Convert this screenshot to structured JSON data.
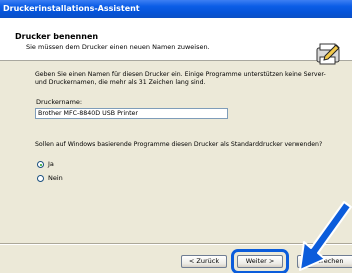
{
  "window": {
    "title": "Druckerinstallations-Assistent"
  },
  "header": {
    "title": "Drucker benennen",
    "subtitle": "Sie müssen dem Drucker einen neuen Namen zuweisen.",
    "icon": "printer-pencil-icon"
  },
  "content": {
    "intro": "Geben Sie einen Namen für diesen Drucker ein. Einige Programme unterstützen keine Server- und Druckernamen, die mehr als 31 Zeichen lang sind.",
    "name_label": "Druckername:",
    "name_value": "Brother MFC-8840D USB Printer",
    "question": "Sollen auf Windows basierende Programme diesen Drucker als Standarddrucker verwenden?",
    "options": [
      {
        "label": "Ja",
        "selected": true
      },
      {
        "label": "Nein",
        "selected": false
      }
    ]
  },
  "buttons": {
    "back": "< Zurück",
    "next": "Weiter >",
    "cancel": "Abbrechen"
  },
  "annotation": {
    "highlight_color": "#0b5cdb",
    "arrow_icon": "pointer-arrow-icon"
  }
}
